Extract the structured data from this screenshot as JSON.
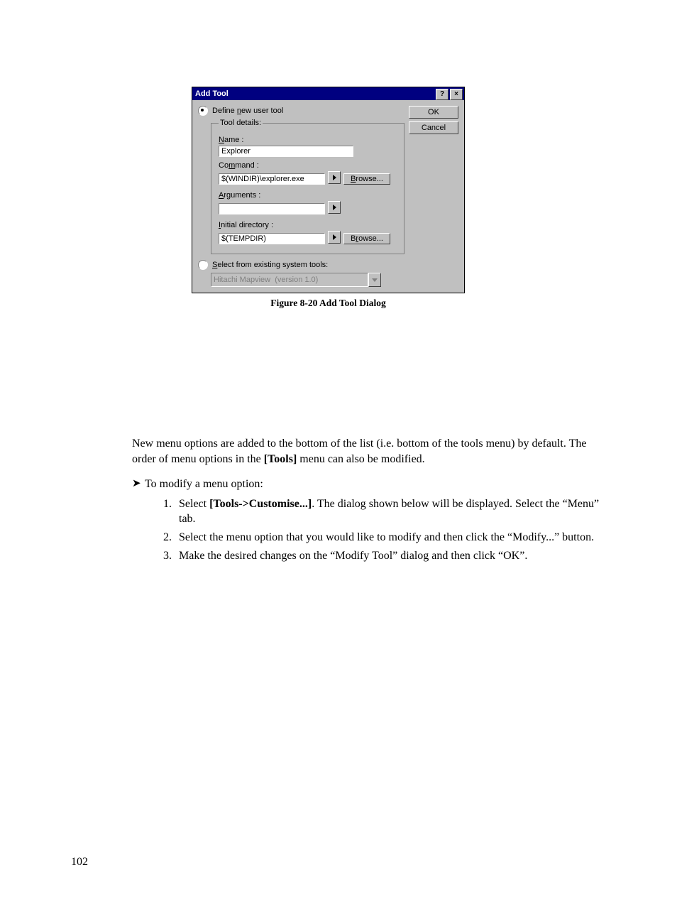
{
  "dialog": {
    "title": "Add Tool",
    "ok": "OK",
    "cancel": "Cancel",
    "radio_define": "Define new user tool",
    "radio_define_ul_letter": "n",
    "fieldset_legend": "Tool details:",
    "name_label": "Name :",
    "name_value": "Explorer",
    "command_label": "Command :",
    "command_value": "$(WINDIR)\\explorer.exe",
    "browse1": "Browse...",
    "arguments_label": "Arguments :",
    "arguments_value": "",
    "initdir_label": "Initial directory :",
    "initdir_value": "$(TEMPDIR)",
    "browse2": "Browse...",
    "radio_select": "Select from existing system tools:",
    "combo_value": "Hitachi Mapview  (version 1.0)"
  },
  "caption": "Figure 8-20 Add Tool Dialog",
  "para1_a": "New menu options are added to the bottom of the list (i.e. bottom of the tools menu) by default. The order of menu options in the ",
  "para1_b": "[Tools]",
  "para1_c": " menu can also be modified.",
  "bullet_text": "To modify a menu option:",
  "steps": {
    "s1a": "Select ",
    "s1b": "[Tools->Customise...]",
    "s1c": ". The dialog shown below will be displayed. Select the “Menu” tab.",
    "s2": "Select the menu option that you would like to modify and then click the “Modify...” button.",
    "s3": "Make the desired changes on the “Modify Tool” dialog and then click “OK”."
  },
  "pagenum": "102"
}
